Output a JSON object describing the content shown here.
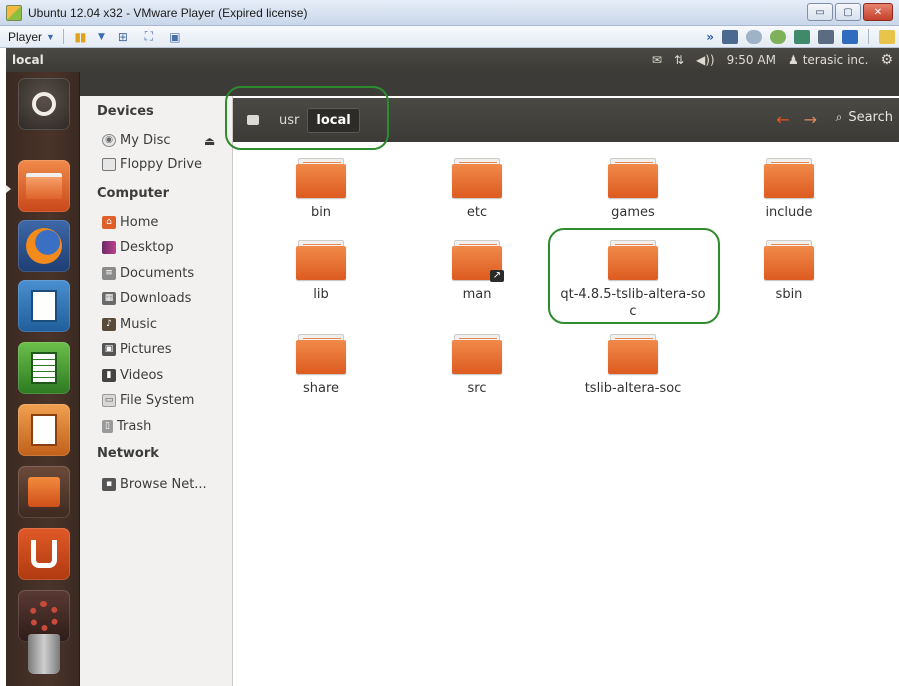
{
  "window": {
    "title": "Ubuntu 12.04 x32 - VMware Player (Expired license)",
    "controls": {
      "minimize": "▭",
      "maximize": "▢",
      "close": "✕"
    }
  },
  "vm_toolbar": {
    "player_label": "Player",
    "more_label": "»"
  },
  "ubuntu_panel": {
    "title": "local",
    "mail_icon": "✉",
    "network_icon": "⇅",
    "volume_icon": "◀))",
    "time": "9:50 AM",
    "user_icon": "♟",
    "user": "terasic inc.",
    "settings_icon": "⚙"
  },
  "launcher": {
    "items": [
      "dash-home",
      "files",
      "firefox",
      "writer",
      "calc",
      "impress",
      "software-center",
      "ubuntu-one",
      "system-settings",
      "trash"
    ]
  },
  "sidebar": {
    "devices_heading": "Devices",
    "computer_heading": "Computer",
    "network_heading": "Network",
    "devices": [
      {
        "label": "My Disc"
      },
      {
        "label": "Floppy Drive"
      }
    ],
    "computer": [
      {
        "label": "Home"
      },
      {
        "label": "Desktop"
      },
      {
        "label": "Documents"
      },
      {
        "label": "Downloads"
      },
      {
        "label": "Music"
      },
      {
        "label": "Pictures"
      },
      {
        "label": "Videos"
      },
      {
        "label": "File System"
      },
      {
        "label": "Trash"
      }
    ],
    "network": [
      {
        "label": "Browse Net..."
      }
    ],
    "eject_icon": "⏏"
  },
  "path_bar": {
    "crumbs": [
      "usr",
      "local"
    ],
    "back_icon": "←",
    "forward_icon": "→",
    "search_icon": "🔍",
    "search_label": "Search"
  },
  "files": [
    {
      "name": "bin",
      "symlink": false
    },
    {
      "name": "etc",
      "symlink": false
    },
    {
      "name": "games",
      "symlink": false
    },
    {
      "name": "include",
      "symlink": false
    },
    {
      "name": "lib",
      "symlink": false
    },
    {
      "name": "man",
      "symlink": true
    },
    {
      "name": "qt-4.8.5-tslib-altera-soc",
      "symlink": false
    },
    {
      "name": "sbin",
      "symlink": false
    },
    {
      "name": "share",
      "symlink": false
    },
    {
      "name": "src",
      "symlink": false
    },
    {
      "name": "tslib-altera-soc",
      "symlink": false
    }
  ],
  "colors": {
    "ubuntu_orange": "#e95420",
    "panel_dark": "#3c3b37",
    "annotation_green": "#2e8b2e"
  }
}
